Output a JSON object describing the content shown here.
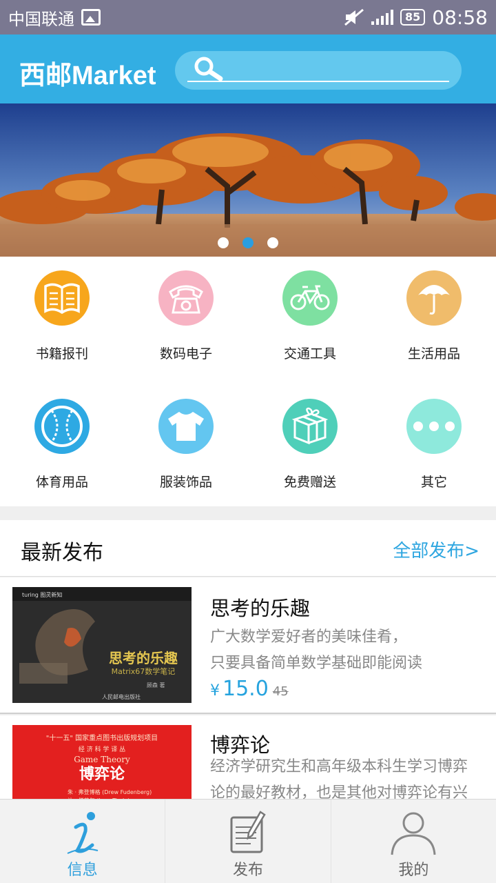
{
  "status": {
    "carrier": "中国联通",
    "battery": "85",
    "time": "08:58"
  },
  "header": {
    "brand": "西邮Market",
    "search_placeholder": ""
  },
  "banner": {
    "dots": 3,
    "active_dot": 1
  },
  "categories": [
    {
      "label": "书籍报刊",
      "icon": "book-icon",
      "color": "#f7a61c"
    },
    {
      "label": "数码电子",
      "icon": "telephone-icon",
      "color": "#f7b3c3"
    },
    {
      "label": "交通工具",
      "icon": "bicycle-icon",
      "color": "#7ee0a1"
    },
    {
      "label": "生活用品",
      "icon": "umbrella-icon",
      "color": "#f0bc6b"
    },
    {
      "label": "体育用品",
      "icon": "baseball-icon",
      "color": "#2ea9e3"
    },
    {
      "label": "服装饰品",
      "icon": "tshirt-icon",
      "color": "#63c6f0"
    },
    {
      "label": "免费赠送",
      "icon": "gift-icon",
      "color": "#4fcfb9"
    },
    {
      "label": "其它",
      "icon": "more-icon",
      "color": "#8ee9dc"
    }
  ],
  "latest": {
    "title": "最新发布",
    "all_link": "全部发布>"
  },
  "items": [
    {
      "title": "思考的乐趣",
      "desc_line1": "广大数学爱好者的美味佳肴，",
      "desc_line2": "只要具备简单数学基础即能阅读",
      "currency": "¥",
      "price": "15.0",
      "old_price": "45",
      "cover_title": "思考的乐趣",
      "cover_sub": "Matrix67数学笔记"
    },
    {
      "title": "博弈论",
      "desc_line1": "经济学研究生和高年级本科生学习博弈",
      "desc_line2": "论的最好教材，也是其他对博弈论有兴",
      "cover_title": "博弈论",
      "cover_sub": "Game Theory"
    }
  ],
  "nav": [
    {
      "label": "信息",
      "icon": "info-icon",
      "active": true
    },
    {
      "label": "发布",
      "icon": "publish-icon",
      "active": false
    },
    {
      "label": "我的",
      "icon": "profile-icon",
      "active": false
    }
  ],
  "colors": {
    "accent": "#33aee3",
    "statusbar": "#7a7891",
    "link": "#2ea6e0"
  }
}
